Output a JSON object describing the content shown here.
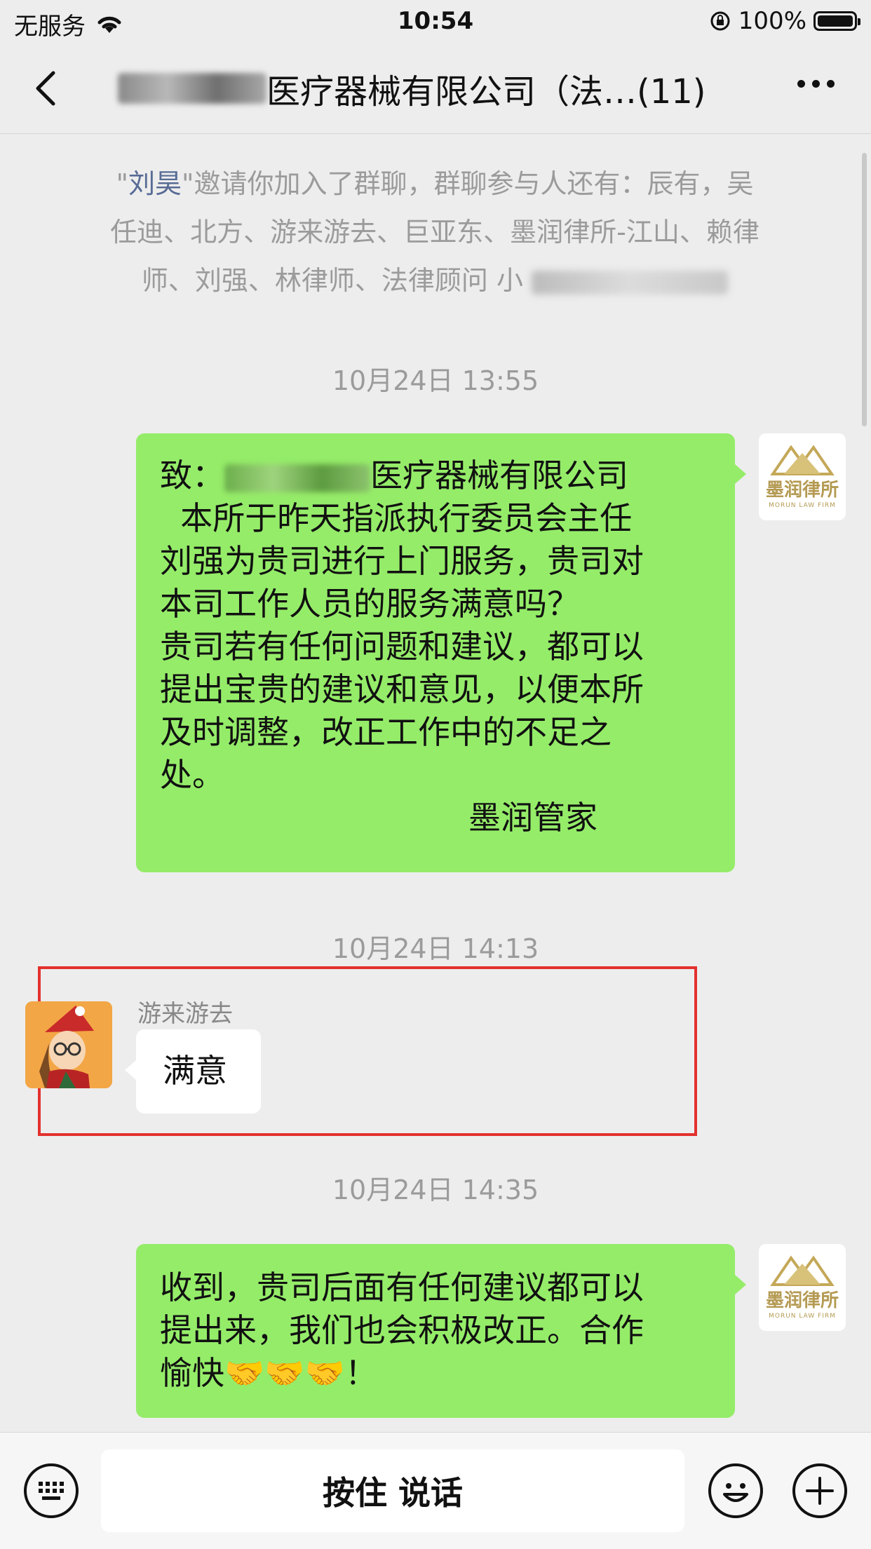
{
  "status_bar": {
    "carrier": "无服务",
    "time": "10:54",
    "battery": "100%"
  },
  "nav": {
    "title": "医疗器械有限公司（法…(11)"
  },
  "system_notice": {
    "quote_open": "\"",
    "inviter": "刘昊",
    "line1_rest": "\"邀请你加入了群聊，群聊参与人还有：辰有，吴",
    "line2": "任迪、北方、游来游去、巨亚东、墨润律所-江山、赖律",
    "line3": "师、刘强、林律师、法律顾问 小"
  },
  "messages": [
    {
      "timestamp": "10月24日 13:55",
      "lines": [
        "致：",
        "医疗器械有限公司",
        "  本所于昨天指派执行委员会主任",
        "刘强为贵司进行上门服务，贵司对",
        "本司工作人员的服务满意吗？",
        "贵司若有任何问题和建议，都可以",
        "提出宝贵的建议和意见，以便本所",
        "及时调整，改正工作中的不足之",
        "处。",
        "墨润管家"
      ]
    },
    {
      "timestamp": "10月24日 14:13",
      "sender": "游来游去",
      "text": "满意"
    },
    {
      "timestamp": "10月24日 14:35",
      "lines": [
        "收到，贵司后面有任何建议都可以",
        "提出来，我们也会积极改正。合作",
        "愉快🤝🤝🤝！"
      ]
    }
  ],
  "firm_avatar": {
    "name": "墨润律所",
    "sub": "MORUN LAW FIRM"
  },
  "input_bar": {
    "voice_label": "按住 说话"
  },
  "colors": {
    "bubble_green": "#95ec69",
    "background": "#ededed",
    "link": "#576b95",
    "highlight_red": "#e3302e"
  }
}
